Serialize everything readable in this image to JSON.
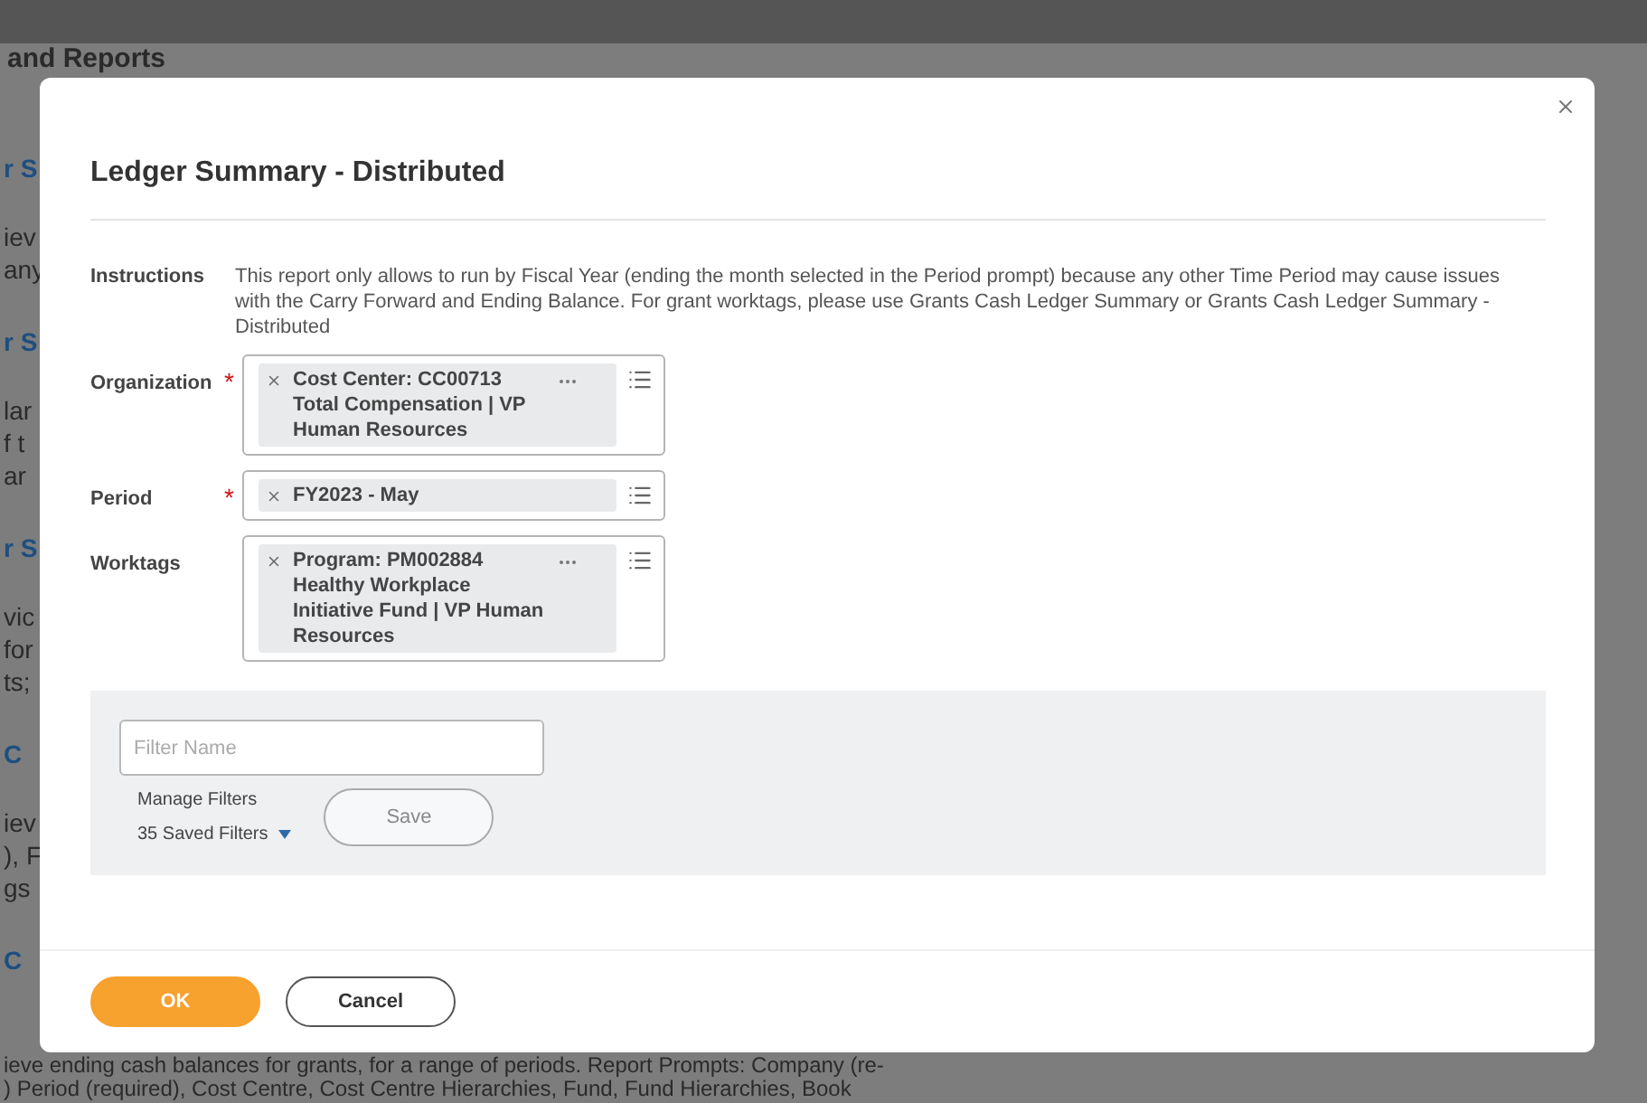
{
  "background": {
    "header": "and Reports",
    "side_lines": [
      {
        "kind": "link",
        "text": "r S"
      },
      {
        "kind": "text",
        "text": "iev"
      },
      {
        "kind": "text",
        "text": "any"
      },
      {
        "kind": "link",
        "text": "r S"
      },
      {
        "kind": "text",
        "text": "lar"
      },
      {
        "kind": "text",
        "text": "f t"
      },
      {
        "kind": "text",
        "text": "ar"
      },
      {
        "kind": "link",
        "text": "r S"
      },
      {
        "kind": "text",
        "text": "vic"
      },
      {
        "kind": "text",
        "text": "for"
      },
      {
        "kind": "text",
        "text": "ts;"
      },
      {
        "kind": "link",
        "text": "C"
      },
      {
        "kind": "text",
        "text": "iev"
      },
      {
        "kind": "text",
        "text": "), F"
      },
      {
        "kind": "text",
        "text": "gs"
      },
      {
        "kind": "link",
        "text": "C"
      }
    ],
    "bottom_lines": [
      "ieve ending cash balances for grants, for a range of periods. Report Prompts: Company (re-",
      ") Period (required), Cost Centre, Cost Centre Hierarchies, Fund, Fund Hierarchies, Book"
    ]
  },
  "dialog": {
    "title": "Ledger Summary - Distributed",
    "instructions": {
      "label": "Instructions",
      "text": "This report only allows to run by Fiscal Year (ending the month selected in the Period prompt) because any other Time Period may cause issues with the Carry Forward and Ending Balance. For grant worktags, please use Grants Cash Ledger Summary or Grants Cash Ledger Summary - Distributed"
    },
    "prompts": [
      {
        "label": "Organization",
        "required_mark": "*",
        "chips": [
          {
            "text": "Cost Center: CC00713 Total Compensation | VP Human Resources",
            "more": true
          }
        ]
      },
      {
        "label": "Period",
        "required_mark": "*",
        "chips": [
          {
            "text": "FY2023 - May",
            "more": false
          }
        ]
      },
      {
        "label": "Worktags",
        "chips": [
          {
            "text": "Program: PM002884 Healthy Workplace Initiative Fund | VP Human Resources",
            "more": true
          }
        ]
      }
    ],
    "filter": {
      "placeholder": "Filter Name",
      "manage": "Manage Filters",
      "saved": "35 Saved Filters",
      "save_button": "Save"
    },
    "buttons": [
      {
        "label": "OK",
        "kind": "primary"
      },
      {
        "label": "Cancel",
        "kind": "secondary"
      }
    ]
  }
}
